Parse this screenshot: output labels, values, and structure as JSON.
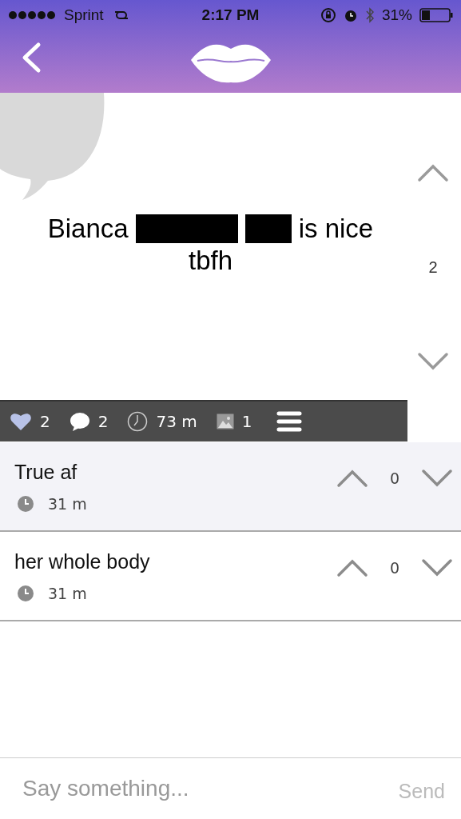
{
  "status_bar": {
    "carrier": "Sprint",
    "time": "2:17 PM",
    "battery": "31%"
  },
  "post": {
    "lines": [
      [
        {
          "kind": "text",
          "text": "Bianca"
        },
        {
          "kind": "redacted_long"
        },
        {
          "kind": "redacted_short"
        },
        {
          "kind": "text",
          "text": "is nice"
        }
      ],
      [
        {
          "kind": "text",
          "text": "tbfh"
        }
      ]
    ],
    "score": "2",
    "stats": {
      "likes": "2",
      "comments": "2",
      "age": "73 m",
      "images": "1"
    }
  },
  "comments": [
    {
      "text": "True af",
      "time": "31 m",
      "score": "0",
      "highlighted": true
    },
    {
      "text": "her whole body",
      "time": "31 m",
      "score": "0",
      "highlighted": false
    }
  ],
  "composer": {
    "placeholder": "Say something...",
    "send": "Send"
  }
}
